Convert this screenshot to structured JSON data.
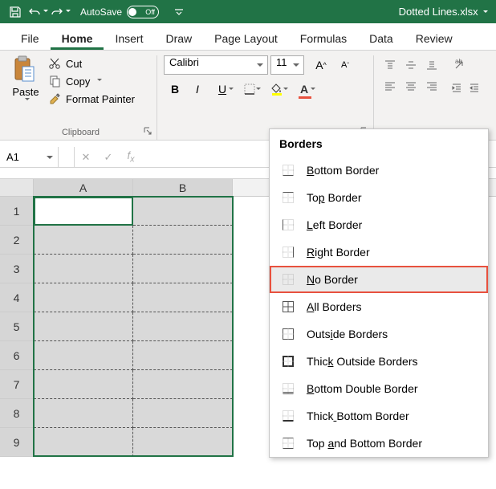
{
  "titlebar": {
    "autosave_label": "AutoSave",
    "autosave_state": "Off",
    "filename": "Dotted Lines.xlsx"
  },
  "tabs": [
    "File",
    "Home",
    "Insert",
    "Draw",
    "Page Layout",
    "Formulas",
    "Data",
    "Review"
  ],
  "active_tab": "Home",
  "clipboard": {
    "paste": "Paste",
    "cut": "Cut",
    "copy": "Copy",
    "format_painter": "Format Painter",
    "group_label": "Clipboard"
  },
  "font": {
    "name": "Calibri",
    "size": "11"
  },
  "namebox": "A1",
  "columns": [
    "A",
    "B"
  ],
  "rows": [
    "1",
    "2",
    "3",
    "4",
    "5",
    "6",
    "7",
    "8",
    "9"
  ],
  "borders_menu": {
    "header": "Borders",
    "underline_map": {
      "Bottom Border": 0,
      "Top Border": 2,
      "Left Border": 0,
      "Right Border": 0,
      "No Border": 0,
      "All Borders": 0,
      "Outside Borders": 4,
      "Thick Outside Borders": 4,
      "Bottom Double Border": 0,
      "Thick Bottom Border": 5,
      "Top and Bottom Border": 4
    },
    "items": [
      "Bottom Border",
      "Top Border",
      "Left Border",
      "Right Border",
      "No Border",
      "All Borders",
      "Outside Borders",
      "Thick Outside Borders",
      "Bottom Double Border",
      "Thick Bottom Border",
      "Top and Bottom Border"
    ],
    "highlighted": "No Border"
  }
}
